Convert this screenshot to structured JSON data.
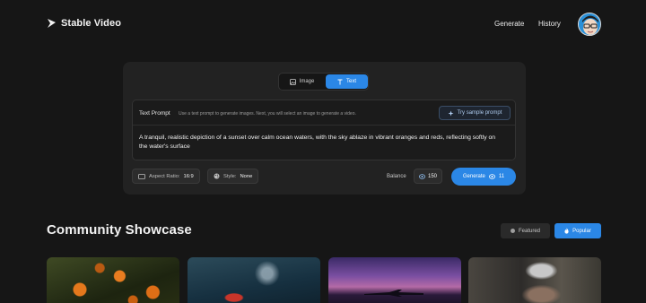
{
  "app": {
    "name": "Stable Video"
  },
  "nav": {
    "generate": "Generate",
    "history": "History"
  },
  "mode": {
    "image_label": "Image",
    "text_label": "Text",
    "selected": "Text"
  },
  "prompt": {
    "label": "Text Prompt",
    "hint": "Use a text prompt to generate images. Next, you will select an image to generate a video.",
    "sample_button": "Try sample prompt",
    "value": "A tranquil, realistic depiction of a sunset over calm ocean waters, with the sky ablaze in vibrant oranges and reds, reflecting softly on the water's surface"
  },
  "options": {
    "aspect_label": "Aspect Ratio:",
    "aspect_value": "16:9",
    "style_label": "Style:",
    "style_value": "None"
  },
  "balance": {
    "label": "Balance",
    "value": "150"
  },
  "generate": {
    "label": "Generate",
    "cost": "11"
  },
  "showcase": {
    "title": "Community Showcase",
    "filters": [
      {
        "label": "Featured",
        "active": false
      },
      {
        "label": "Popular",
        "active": true
      }
    ]
  },
  "colors": {
    "accent": "#2b87e6",
    "background": "#161616",
    "card": "#222222"
  },
  "icons": [
    "logo-icon",
    "image-icon",
    "text-icon",
    "sparkle-icon",
    "aspect-ratio-icon",
    "palette-icon",
    "coin-icon",
    "flame-icon"
  ]
}
